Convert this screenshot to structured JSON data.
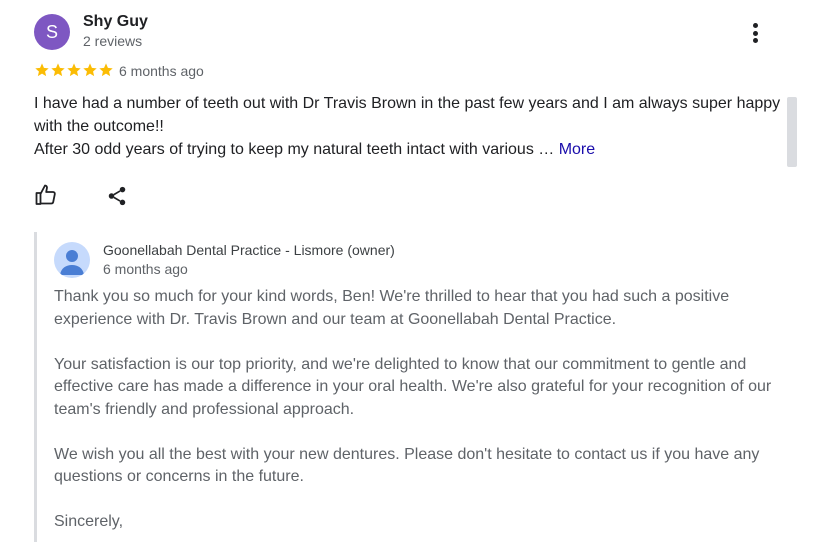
{
  "review": {
    "avatar_letter": "S",
    "avatar_color": "#7e57c2",
    "name": "Shy Guy",
    "meta": "2 reviews",
    "rating": 5,
    "star_color": "#fbbc04",
    "time": "6 months ago",
    "text_line1": "I have had a number of teeth out with Dr Travis Brown in the past few years and I am always super happy with the outcome!!",
    "text_line2": "After 30 odd years of trying to keep my natural teeth intact with various … ",
    "more_label": "More",
    "menu_icon": "more-vert-icon",
    "like_icon": "thumb-up-icon",
    "share_icon": "share-icon"
  },
  "owner": {
    "name": "Goonellabah Dental Practice - Lismore (owner)",
    "time": "6 months ago",
    "paragraphs": [
      "Thank you so much for your kind words, Ben! We're thrilled to hear that you had such a positive experience with Dr. Travis Brown and our team at Goonellabah Dental Practice.",
      "Your satisfaction is our top priority, and we're delighted to know that our commitment to gentle and effective care has made a difference in your oral health. We're also grateful for your recognition of our team's friendly and professional approach.",
      "We wish you all the best with your new dentures. Please don't hesitate to contact us if you have any questions or concerns in the future.",
      "Sincerely,"
    ]
  }
}
